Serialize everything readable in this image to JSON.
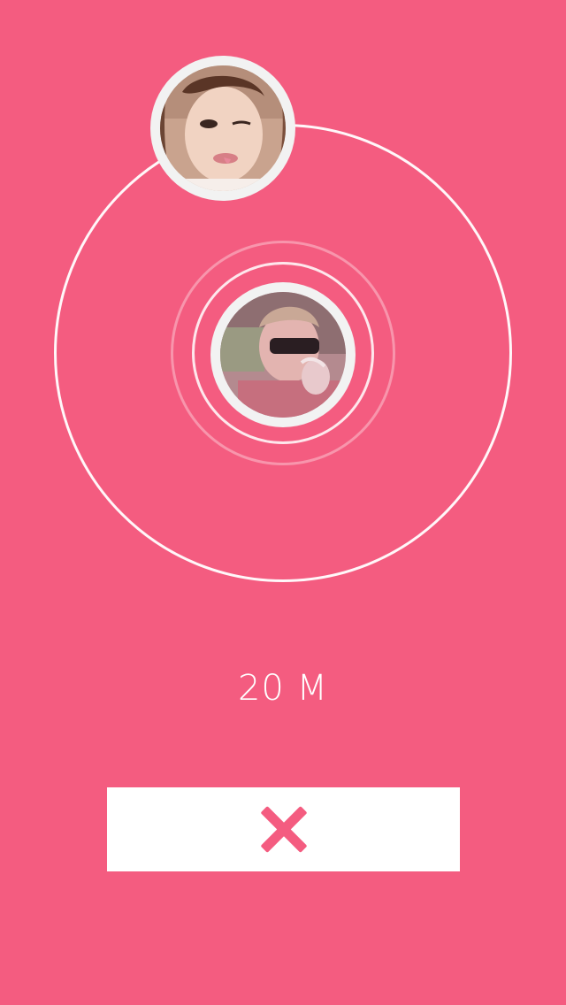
{
  "radar": {
    "distance_label": "20 M"
  },
  "avatars": {
    "match": {
      "icon": "profile-photo-woman"
    },
    "self": {
      "icon": "profile-photo-man"
    }
  },
  "actions": {
    "cancel_icon": "close-icon"
  },
  "colors": {
    "background": "#F45C80",
    "ring": "#FFFFFF",
    "avatar_border": "#F2F2F2",
    "button": "#FFFFFF",
    "icon": "#F45C80"
  }
}
